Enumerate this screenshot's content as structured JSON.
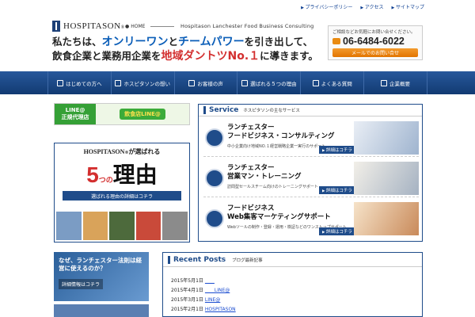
{
  "top_links": [
    "プライバシーポリシー",
    "アクセス",
    "サイトマップ"
  ],
  "logo": {
    "brand": "HOSPITASON",
    "reg": "®"
  },
  "header": {
    "home_label": "HOME",
    "tagline": "Hospitason  Lanchester Food Business Consulting",
    "headline": {
      "p1": "私たちは、",
      "p2": "オンリーワン",
      "p3": "と",
      "p4": "チームパワー",
      "p5": "を引き出して、",
      "p6": "飲食企業と業務用企業を",
      "p7": "地域ダントツNo.１",
      "p8": "に導きます。"
    }
  },
  "contact": {
    "note": "ご相談などお気軽にお問い合せください。",
    "tel": "06-6484-6022",
    "mail_button": "メールでのお問い合せ"
  },
  "nav": [
    {
      "label": "はじめての方へ",
      "icon": "book-icon"
    },
    {
      "label": "ホスピタソンの想い",
      "icon": "pen-icon"
    },
    {
      "label": "お客様の声",
      "icon": "speech-bubble-icon"
    },
    {
      "label": "選ばれる５つの理由",
      "icon": "check-icon"
    },
    {
      "label": "よくある質問",
      "icon": "question-icon"
    },
    {
      "label": "企業概要",
      "icon": "building-icon"
    }
  ],
  "line_banner": {
    "left_line1": "LINE@",
    "left_line2": "正規代理店",
    "right": "飲食店LINE@"
  },
  "reasons": {
    "top_brand": "HOSPITASON",
    "top_reg": "®",
    "top_suffix": "が選ばれる",
    "num": "5",
    "small": "つの",
    "word": "理由",
    "cta": "選ばれる理由の詳細はコチラ"
  },
  "law_banner": {
    "title": "なぜ、ランチェスター法則は経営に使えるのか？",
    "button": "詳細情報はコチラ"
  },
  "service": {
    "title": "Service",
    "subtitle": "ホスピタソンの主なサービス",
    "items": [
      {
        "title1": "ランチェスター",
        "title2": "フードビジネス・コンサルティング",
        "desc": "中小企業向け地域NO.１経営戦略企業一実行のサポート",
        "more": "詳細はコチラ",
        "icon": "chart-icon"
      },
      {
        "title1": "ランチェスター",
        "title2": "営業マン・トレーニング",
        "desc": "訪問型セールスチーム向けのトレーニングサポート",
        "more": "詳細はコチラ",
        "icon": "person-icon"
      },
      {
        "title1": "フードビジネス",
        "title2": "Web集客マーケティングサポート",
        "desc": "Webツールの制作・登録・運用・検証などのワンストップサポート",
        "more": "詳細はコチラ",
        "icon": "monitor-icon"
      }
    ]
  },
  "recent": {
    "title": "Recent Posts",
    "subtitle": "ブログ最新記事",
    "posts": [
      {
        "date": "2015年5月1日",
        "link": "　　"
      },
      {
        "date": "2015年4月1日",
        "link": "　　LINE@"
      },
      {
        "date": "2015年3月1日",
        "link": "LINE@"
      },
      {
        "date": "2015年2月1日",
        "link": "HOSPITASON"
      }
    ]
  },
  "colors": {
    "navy": "#1f4c8a",
    "accent_blue": "#0b5eb8",
    "accent_red": "#d32f2f",
    "line_green": "#35a036",
    "mail_orange": "#e98b12"
  }
}
